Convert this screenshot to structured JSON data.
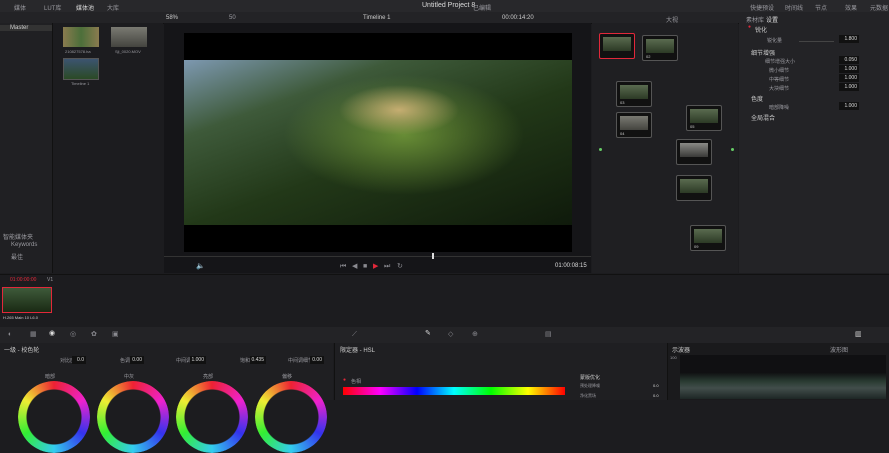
{
  "toolbar": {
    "items": [
      "媒体",
      "LUT库",
      "媒体池",
      "大库"
    ],
    "project_title": "Untitled Project 8",
    "project_status": "已编辑",
    "right_items": [
      "快捷预设",
      "时间线",
      "节点",
      "效果",
      "元数据"
    ]
  },
  "media": {
    "master_label": "Master",
    "clips": [
      {
        "name": "210827578.ha"
      },
      {
        "name": "Sjl_0020.MOV"
      },
      {
        "name": "Timeline 1"
      }
    ],
    "smart_bins": "智能媒体夹",
    "keywords": "Keywords",
    "user": "最佳"
  },
  "viewer": {
    "zoom": "58%",
    "frame_field": "50",
    "timeline_name": "Timeline 1",
    "timecode": "00:00:14:20",
    "playhead_tc": "01:00:08:15",
    "clip_label": "大视"
  },
  "nodes": {
    "labels": [
      "01",
      "02",
      "03",
      "04",
      "05",
      "06",
      "07",
      "08",
      "09"
    ]
  },
  "inspector": {
    "tabs": [
      "素材库",
      "设置"
    ],
    "section1": "锐化",
    "section1_field": "锐化量",
    "section1_value": "1.800",
    "section2": "细节增强",
    "rows": [
      {
        "label": "细节增强大小",
        "value": "0.050"
      },
      {
        "label": "微小细节",
        "value": "1.000"
      },
      {
        "label": "中等细节",
        "value": "1.000"
      },
      {
        "label": "大块细节",
        "value": "1.000"
      }
    ],
    "section3": "色度",
    "section3_field": "暗部降噪",
    "section3_value": "1.000",
    "section4": "全局混合"
  },
  "timeline": {
    "tc": "01:00:00:00",
    "track": "V1",
    "clip_name": "H.265 Main 10 L6.0"
  },
  "color": {
    "panel_title": "一级 - 校色轮",
    "params": [
      {
        "label": "对比度",
        "value": "0.0"
      },
      {
        "label": "色调",
        "value": "0.00"
      },
      {
        "label": "中间调细节",
        "value": "1.000"
      },
      {
        "label": "饱和",
        "value": "0.435"
      },
      {
        "label": "中间调细节",
        "value": "0.00"
      }
    ],
    "wheels": [
      "暗部",
      "中灰",
      "亮部",
      "偏移"
    ],
    "qualifier_title": "限定器 - HSL",
    "qualifier_item": "色相",
    "mix_title": "蒙版优化",
    "mix_rows": [
      {
        "label": "预处理降噪",
        "value": "0.0"
      },
      {
        "label": "净化黑场",
        "value": "0.0"
      }
    ],
    "scope_title": "示波器",
    "scope_mode": "波形图",
    "scope_max": "100"
  },
  "colors": {
    "accent_red": "#e2283a",
    "playhead": "#e0e0e0"
  }
}
